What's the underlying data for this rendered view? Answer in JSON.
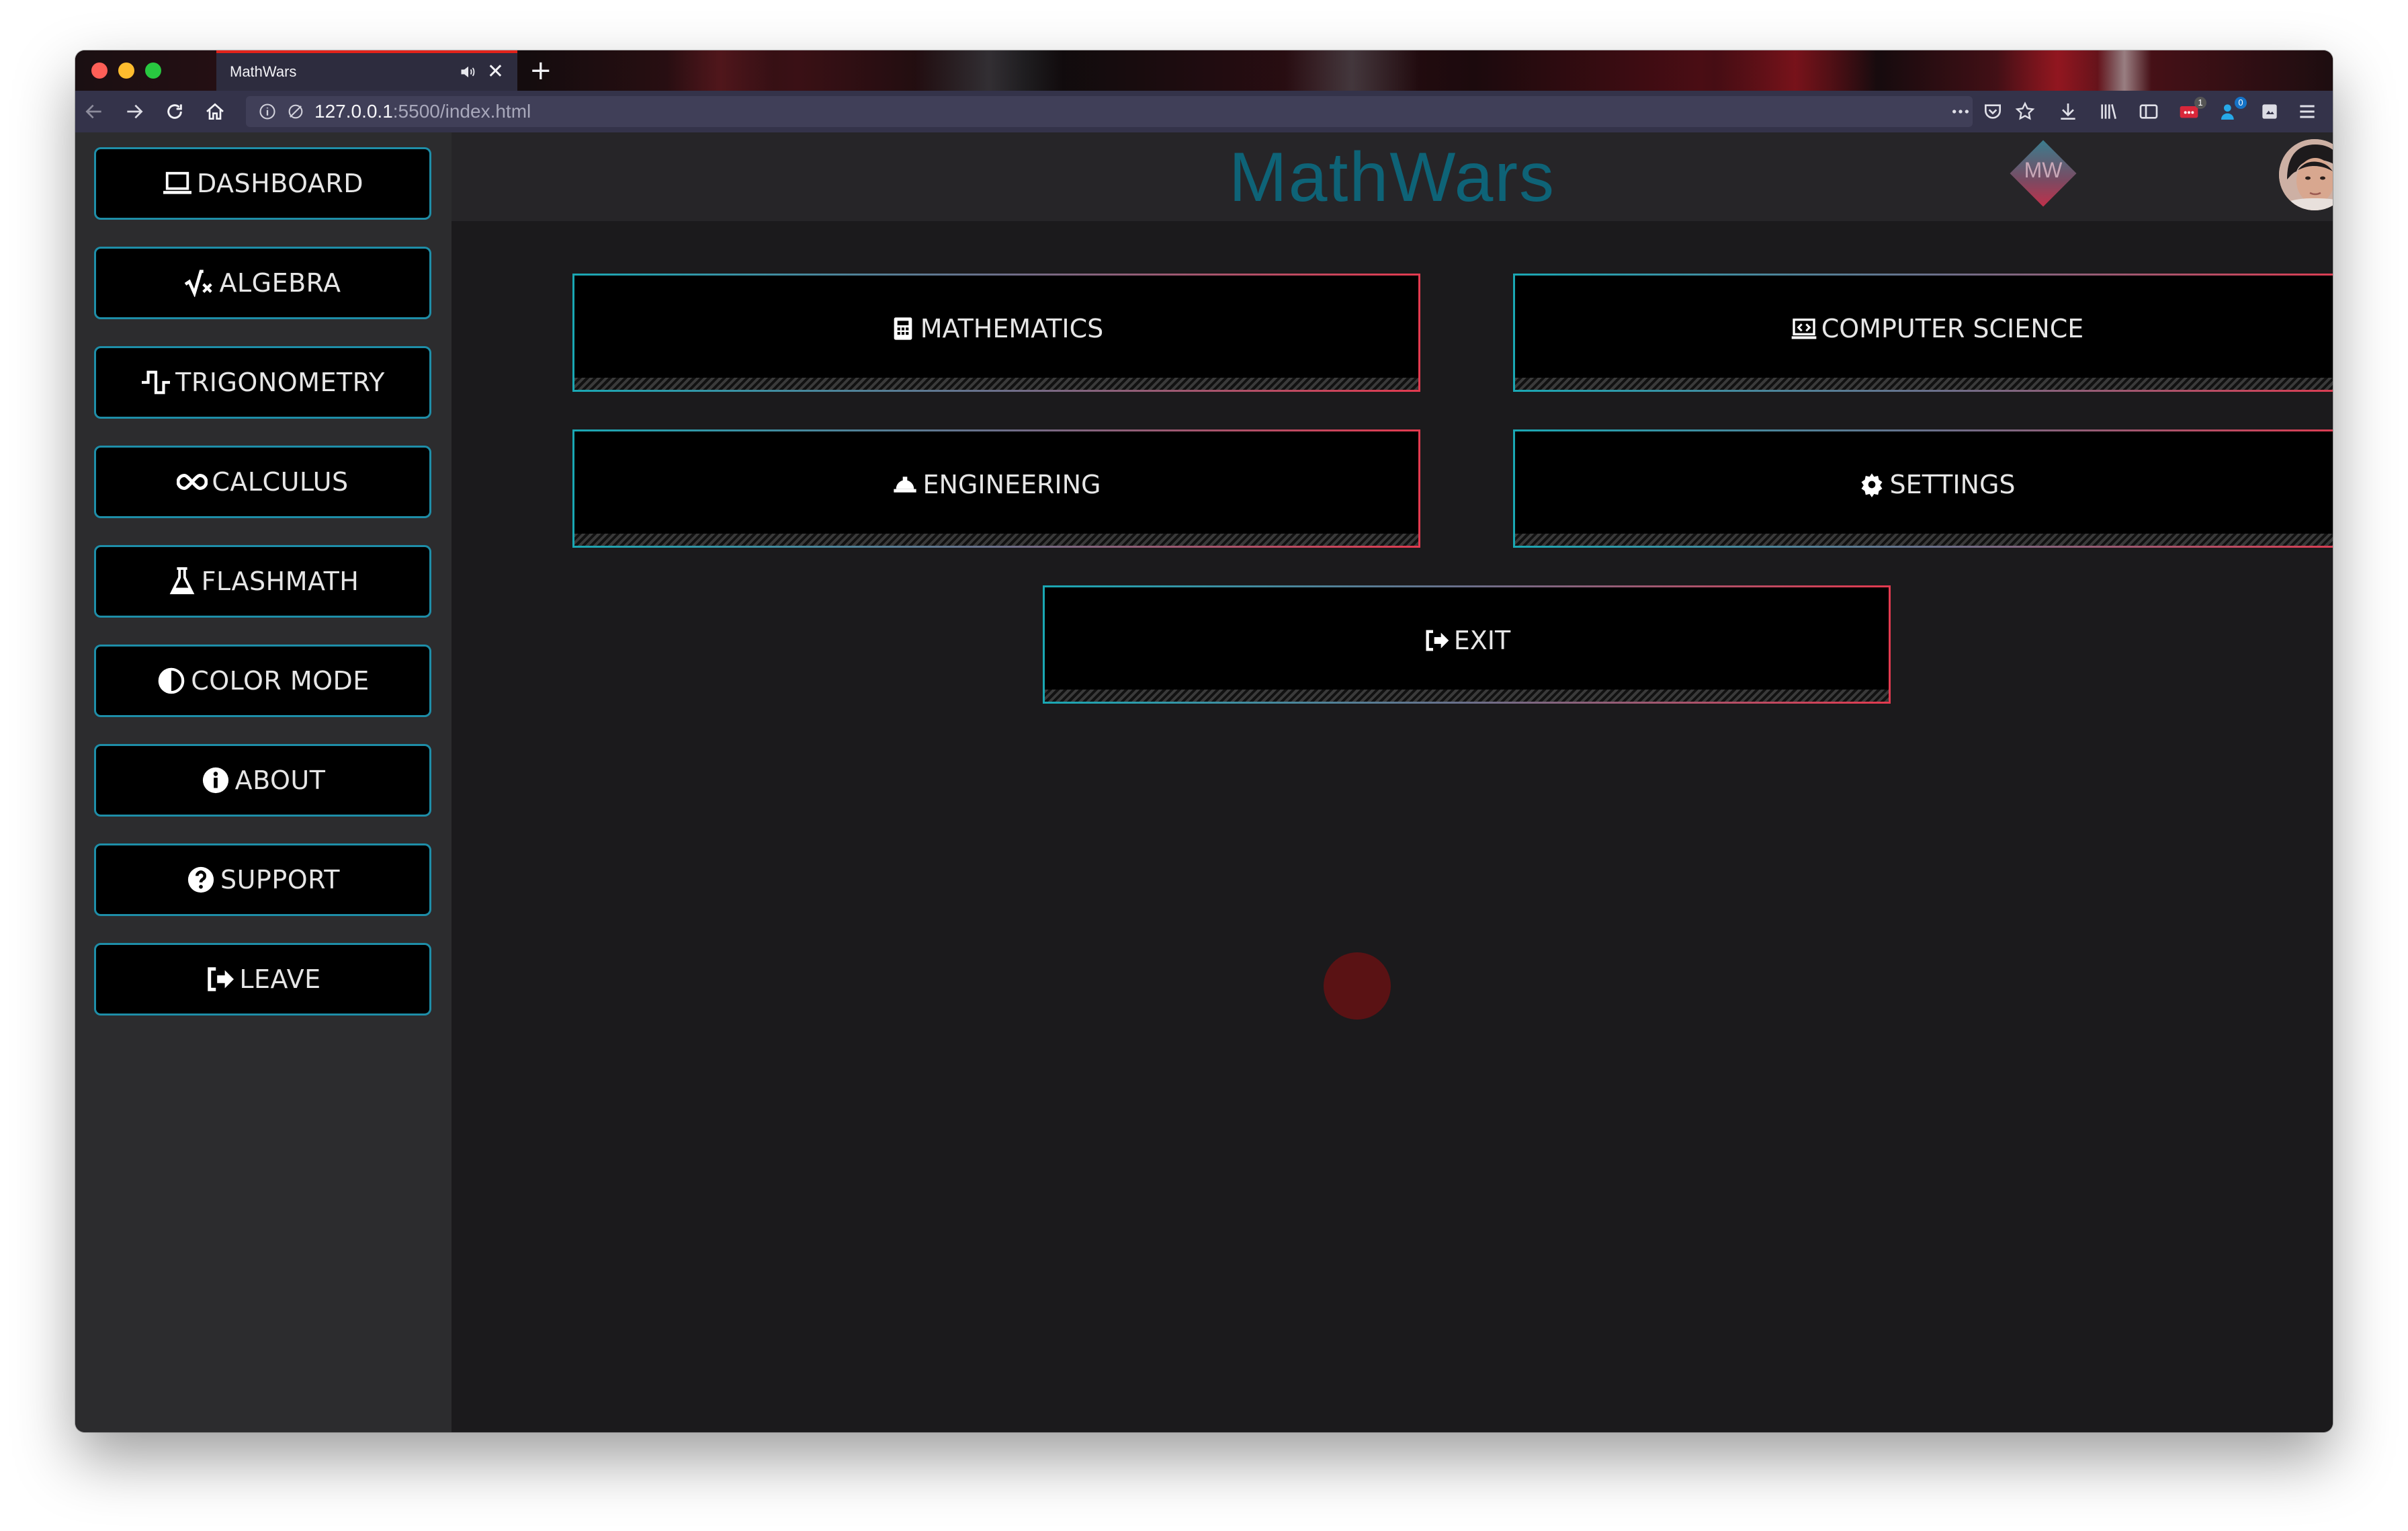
{
  "browser": {
    "tab_title": "MathWars",
    "url_host": "127.0.0.1",
    "url_path": ":5500/index.html",
    "badges": {
      "extension_1": "1",
      "extension_2": "0"
    }
  },
  "header": {
    "title": "MathWars",
    "logo_text": "MW"
  },
  "sidebar": {
    "items": [
      {
        "label": "DASHBOARD",
        "icon": "laptop-icon"
      },
      {
        "label": "ALGEBRA",
        "icon": "square-root-icon"
      },
      {
        "label": "TRIGONOMETRY",
        "icon": "waveform-icon"
      },
      {
        "label": "CALCULUS",
        "icon": "infinity-icon"
      },
      {
        "label": "FLASHMATH",
        "icon": "flask-icon"
      },
      {
        "label": "COLOR MODE",
        "icon": "half-circle-icon"
      },
      {
        "label": "ABOUT",
        "icon": "info-icon"
      },
      {
        "label": "SUPPORT",
        "icon": "question-icon"
      },
      {
        "label": "LEAVE",
        "icon": "sign-out-icon"
      }
    ]
  },
  "main": {
    "buttons": [
      {
        "label": "MATHEMATICS",
        "icon": "calculator-icon"
      },
      {
        "label": "COMPUTER SCIENCE",
        "icon": "code-laptop-icon"
      },
      {
        "label": "ENGINEERING",
        "icon": "hard-hat-icon"
      },
      {
        "label": "SETTINGS",
        "icon": "gear-icon"
      },
      {
        "label": "EXIT",
        "icon": "sign-out-icon"
      }
    ]
  },
  "colors": {
    "accent_teal": "#0e6377",
    "sidebar_border": "#1e8ea8",
    "button_gradient_start": "#1aa7b3",
    "button_gradient_end": "#e23a4f"
  }
}
